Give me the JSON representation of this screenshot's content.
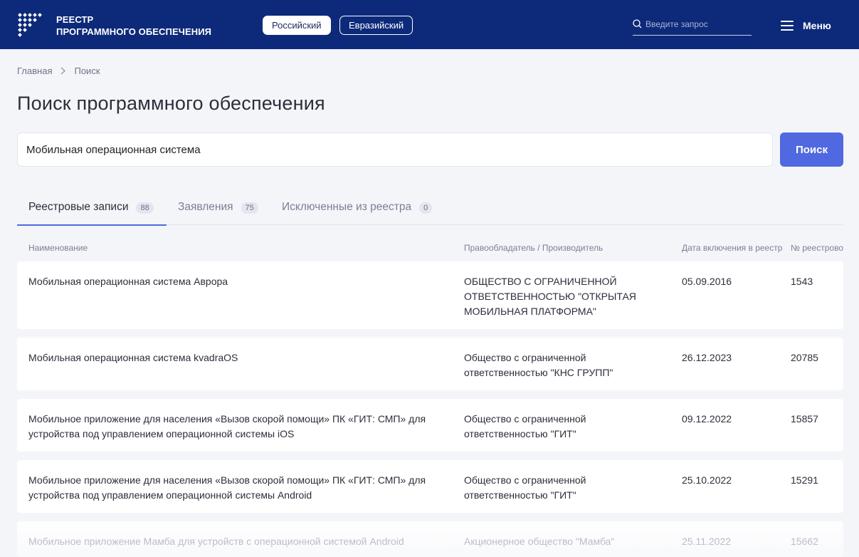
{
  "header": {
    "brand_line1": "РЕЕСТР",
    "brand_line2": "ПРОГРАММНОГО ОБЕСПЕЧЕНИЯ",
    "registry_tabs": [
      "Российский",
      "Евразийский"
    ],
    "search_placeholder": "Введите запрос",
    "menu_label": "Меню"
  },
  "breadcrumb": [
    "Главная",
    "Поиск"
  ],
  "page_title": "Поиск программного обеспечения",
  "search": {
    "value": "Мобильная операционная система",
    "button_label": "Поиск"
  },
  "tabs": [
    {
      "label": "Реестровые записи",
      "count": "88",
      "active": true
    },
    {
      "label": "Заявления",
      "count": "75",
      "active": false
    },
    {
      "label": "Исключенные из реестра",
      "count": "0",
      "active": false
    }
  ],
  "table": {
    "columns": [
      "Наименование",
      "Правообладатель / Производитель",
      "Дата включения в реестр",
      "№ реестрово"
    ],
    "rows": [
      {
        "name": "Мобильная операционная система Аврора",
        "owner": "ОБЩЕСТВО С ОГРАНИЧЕННОЙ ОТВЕТСТВЕННОСТЬЮ \"ОТКРЫТАЯ МОБИЛЬНАЯ ПЛАТФОРМА\"",
        "date": "05.09.2016",
        "number": "1543"
      },
      {
        "name": "Мобильная операционная система kvadraOS",
        "owner": "Общество с ограниченной ответственностью \"КНС ГРУПП\"",
        "date": "26.12.2023",
        "number": "20785"
      },
      {
        "name": "Мобильное приложение для населения «Вызов скорой помощи» ПК «ГИТ: СМП» для устройства под управлением операционной системы iOS",
        "owner": "Общество с ограниченной ответственностью \"ГИТ\"",
        "date": "09.12.2022",
        "number": "15857"
      },
      {
        "name": "Мобильное приложение для населения «Вызов скорой помощи» ПК «ГИТ: СМП» для устройства под управлением операционной системы Android",
        "owner": "Общество с ограниченной ответственностью \"ГИТ\"",
        "date": "25.10.2022",
        "number": "15291"
      },
      {
        "name": "Мобильное приложение Мамба для устройств с операционной системой Android",
        "owner": "Акционерное общество \"Мамба\"",
        "date": "25.11.2022",
        "number": "15662"
      }
    ]
  },
  "colors": {
    "header_bg": "#0d2a7a",
    "accent": "#5069e0",
    "page_bg": "#f4f5f9"
  }
}
